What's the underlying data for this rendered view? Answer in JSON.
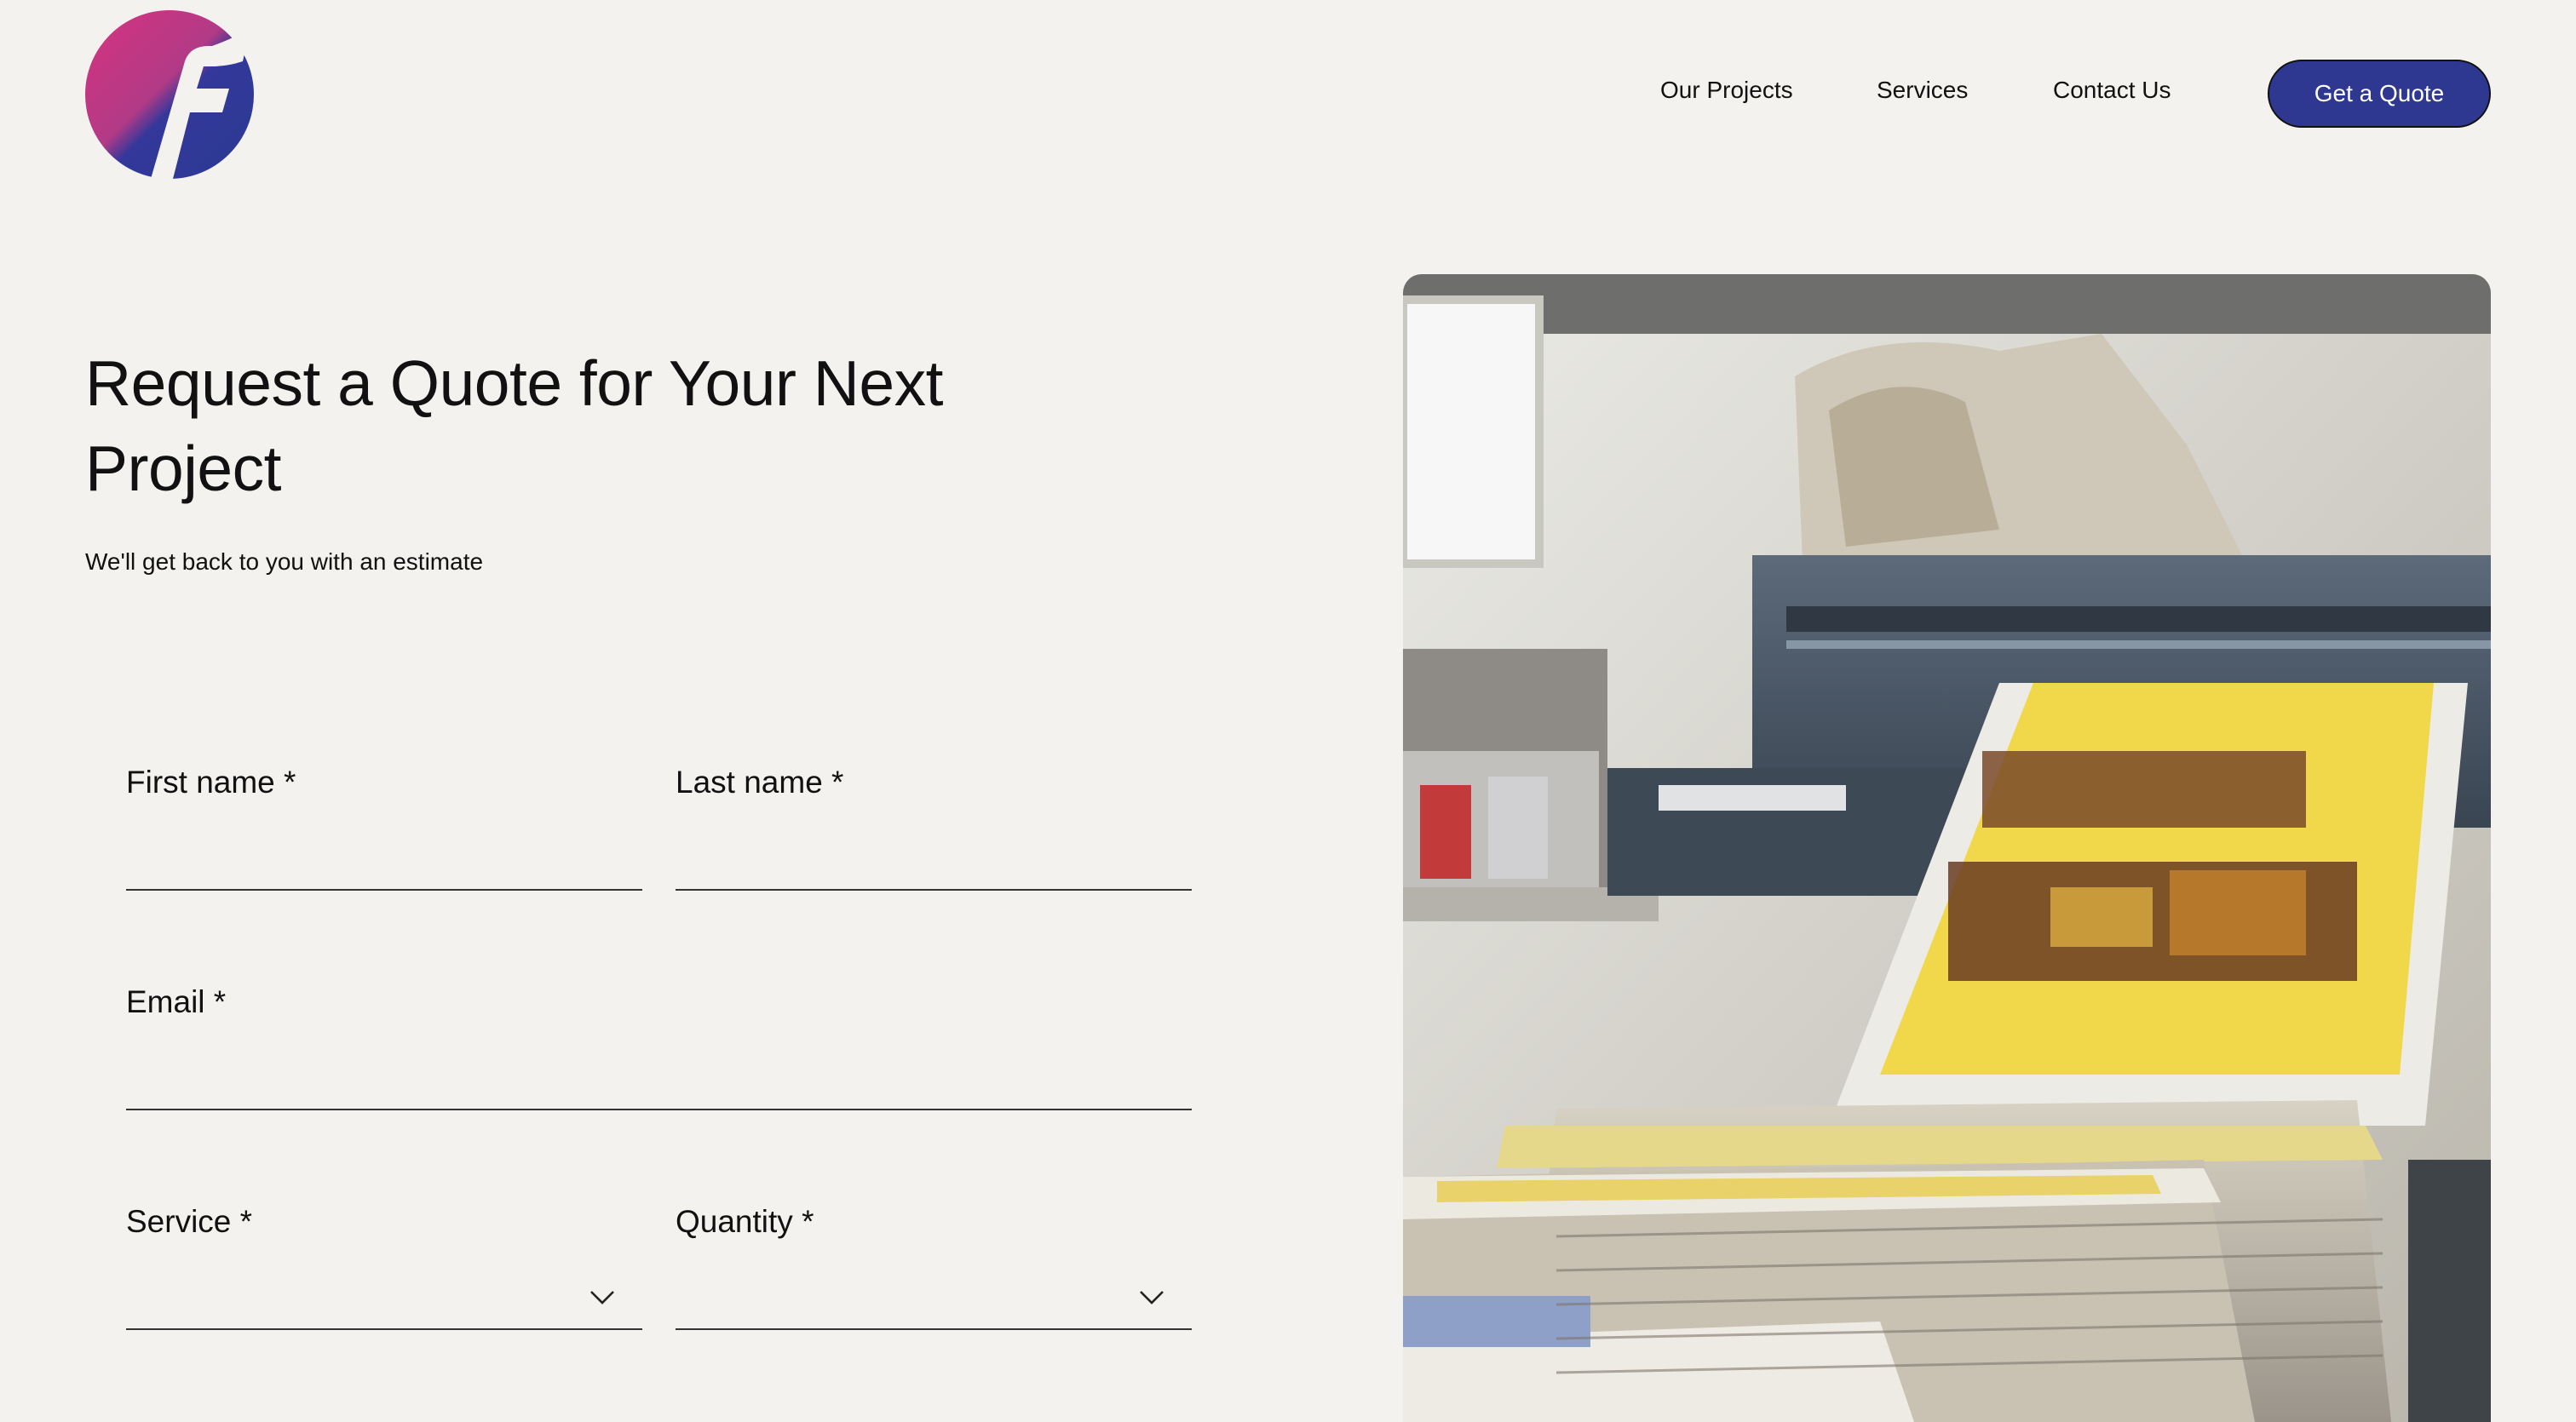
{
  "header": {
    "logo_letter": "F",
    "nav": {
      "projects": "Our Projects",
      "services": "Services",
      "contact": "Contact Us"
    },
    "cta": "Get a Quote"
  },
  "hero": {
    "title": "Request a Quote for Your Next Project",
    "subtitle": "We'll get back to you with an estimate"
  },
  "form": {
    "first_name": {
      "label": "First name *",
      "value": ""
    },
    "last_name": {
      "label": "Last name *",
      "value": ""
    },
    "email": {
      "label": "Email *",
      "value": ""
    },
    "service": {
      "label": "Service *",
      "value": ""
    },
    "quantity": {
      "label": "Quantity *",
      "value": ""
    }
  },
  "colors": {
    "background": "#f3f2ee",
    "brand_blue": "#2e3890",
    "brand_pink": "#d6337e"
  },
  "icons": {
    "logo": "logo-f-icon",
    "dropdown": "chevron-down-icon"
  }
}
